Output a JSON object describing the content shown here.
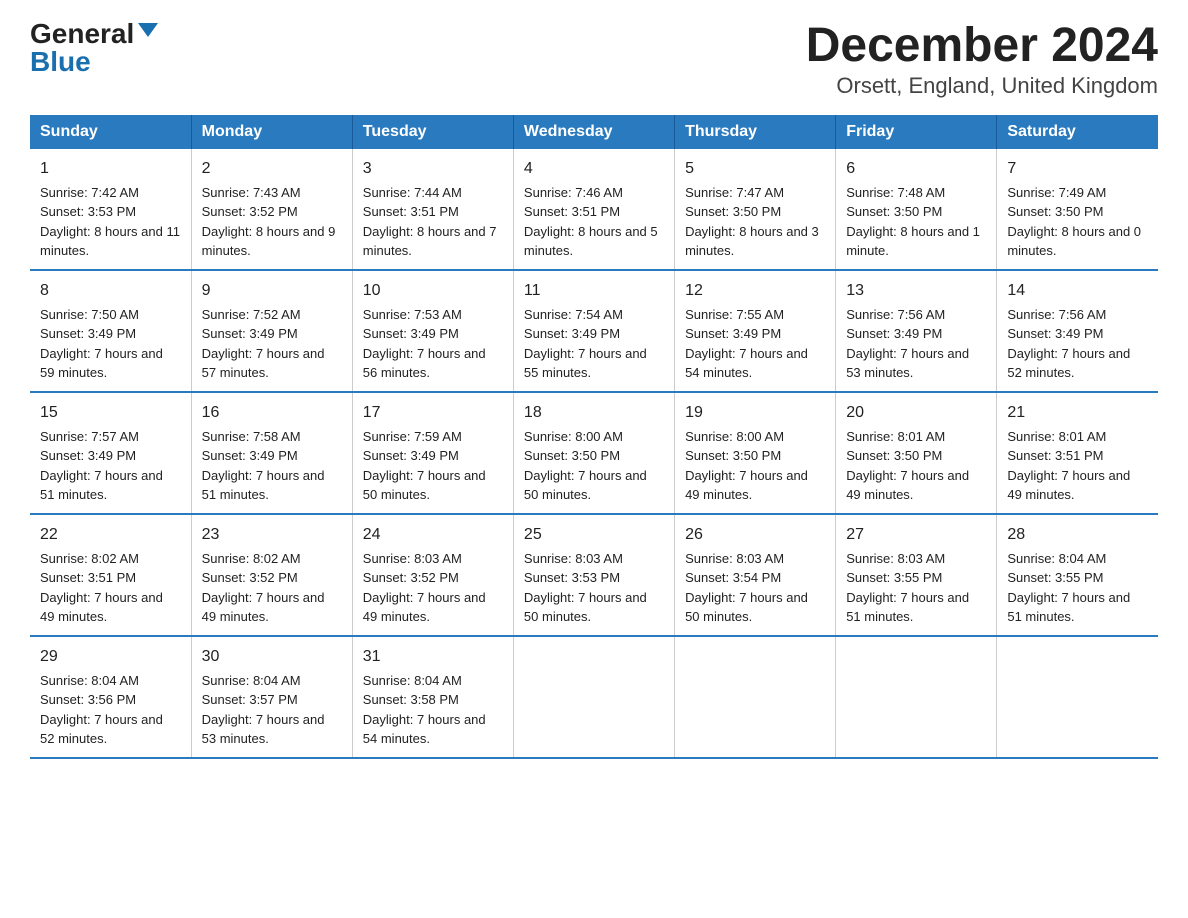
{
  "header": {
    "logo_general": "General",
    "logo_blue": "Blue",
    "title": "December 2024",
    "subtitle": "Orsett, England, United Kingdom"
  },
  "days_of_week": [
    "Sunday",
    "Monday",
    "Tuesday",
    "Wednesday",
    "Thursday",
    "Friday",
    "Saturday"
  ],
  "weeks": [
    [
      {
        "day": "1",
        "sunrise": "7:42 AM",
        "sunset": "3:53 PM",
        "daylight": "8 hours and 11 minutes"
      },
      {
        "day": "2",
        "sunrise": "7:43 AM",
        "sunset": "3:52 PM",
        "daylight": "8 hours and 9 minutes"
      },
      {
        "day": "3",
        "sunrise": "7:44 AM",
        "sunset": "3:51 PM",
        "daylight": "8 hours and 7 minutes"
      },
      {
        "day": "4",
        "sunrise": "7:46 AM",
        "sunset": "3:51 PM",
        "daylight": "8 hours and 5 minutes"
      },
      {
        "day": "5",
        "sunrise": "7:47 AM",
        "sunset": "3:50 PM",
        "daylight": "8 hours and 3 minutes"
      },
      {
        "day": "6",
        "sunrise": "7:48 AM",
        "sunset": "3:50 PM",
        "daylight": "8 hours and 1 minute"
      },
      {
        "day": "7",
        "sunrise": "7:49 AM",
        "sunset": "3:50 PM",
        "daylight": "8 hours and 0 minutes"
      }
    ],
    [
      {
        "day": "8",
        "sunrise": "7:50 AM",
        "sunset": "3:49 PM",
        "daylight": "7 hours and 59 minutes"
      },
      {
        "day": "9",
        "sunrise": "7:52 AM",
        "sunset": "3:49 PM",
        "daylight": "7 hours and 57 minutes"
      },
      {
        "day": "10",
        "sunrise": "7:53 AM",
        "sunset": "3:49 PM",
        "daylight": "7 hours and 56 minutes"
      },
      {
        "day": "11",
        "sunrise": "7:54 AM",
        "sunset": "3:49 PM",
        "daylight": "7 hours and 55 minutes"
      },
      {
        "day": "12",
        "sunrise": "7:55 AM",
        "sunset": "3:49 PM",
        "daylight": "7 hours and 54 minutes"
      },
      {
        "day": "13",
        "sunrise": "7:56 AM",
        "sunset": "3:49 PM",
        "daylight": "7 hours and 53 minutes"
      },
      {
        "day": "14",
        "sunrise": "7:56 AM",
        "sunset": "3:49 PM",
        "daylight": "7 hours and 52 minutes"
      }
    ],
    [
      {
        "day": "15",
        "sunrise": "7:57 AM",
        "sunset": "3:49 PM",
        "daylight": "7 hours and 51 minutes"
      },
      {
        "day": "16",
        "sunrise": "7:58 AM",
        "sunset": "3:49 PM",
        "daylight": "7 hours and 51 minutes"
      },
      {
        "day": "17",
        "sunrise": "7:59 AM",
        "sunset": "3:49 PM",
        "daylight": "7 hours and 50 minutes"
      },
      {
        "day": "18",
        "sunrise": "8:00 AM",
        "sunset": "3:50 PM",
        "daylight": "7 hours and 50 minutes"
      },
      {
        "day": "19",
        "sunrise": "8:00 AM",
        "sunset": "3:50 PM",
        "daylight": "7 hours and 49 minutes"
      },
      {
        "day": "20",
        "sunrise": "8:01 AM",
        "sunset": "3:50 PM",
        "daylight": "7 hours and 49 minutes"
      },
      {
        "day": "21",
        "sunrise": "8:01 AM",
        "sunset": "3:51 PM",
        "daylight": "7 hours and 49 minutes"
      }
    ],
    [
      {
        "day": "22",
        "sunrise": "8:02 AM",
        "sunset": "3:51 PM",
        "daylight": "7 hours and 49 minutes"
      },
      {
        "day": "23",
        "sunrise": "8:02 AM",
        "sunset": "3:52 PM",
        "daylight": "7 hours and 49 minutes"
      },
      {
        "day": "24",
        "sunrise": "8:03 AM",
        "sunset": "3:52 PM",
        "daylight": "7 hours and 49 minutes"
      },
      {
        "day": "25",
        "sunrise": "8:03 AM",
        "sunset": "3:53 PM",
        "daylight": "7 hours and 50 minutes"
      },
      {
        "day": "26",
        "sunrise": "8:03 AM",
        "sunset": "3:54 PM",
        "daylight": "7 hours and 50 minutes"
      },
      {
        "day": "27",
        "sunrise": "8:03 AM",
        "sunset": "3:55 PM",
        "daylight": "7 hours and 51 minutes"
      },
      {
        "day": "28",
        "sunrise": "8:04 AM",
        "sunset": "3:55 PM",
        "daylight": "7 hours and 51 minutes"
      }
    ],
    [
      {
        "day": "29",
        "sunrise": "8:04 AM",
        "sunset": "3:56 PM",
        "daylight": "7 hours and 52 minutes"
      },
      {
        "day": "30",
        "sunrise": "8:04 AM",
        "sunset": "3:57 PM",
        "daylight": "7 hours and 53 minutes"
      },
      {
        "day": "31",
        "sunrise": "8:04 AM",
        "sunset": "3:58 PM",
        "daylight": "7 hours and 54 minutes"
      },
      null,
      null,
      null,
      null
    ]
  ]
}
